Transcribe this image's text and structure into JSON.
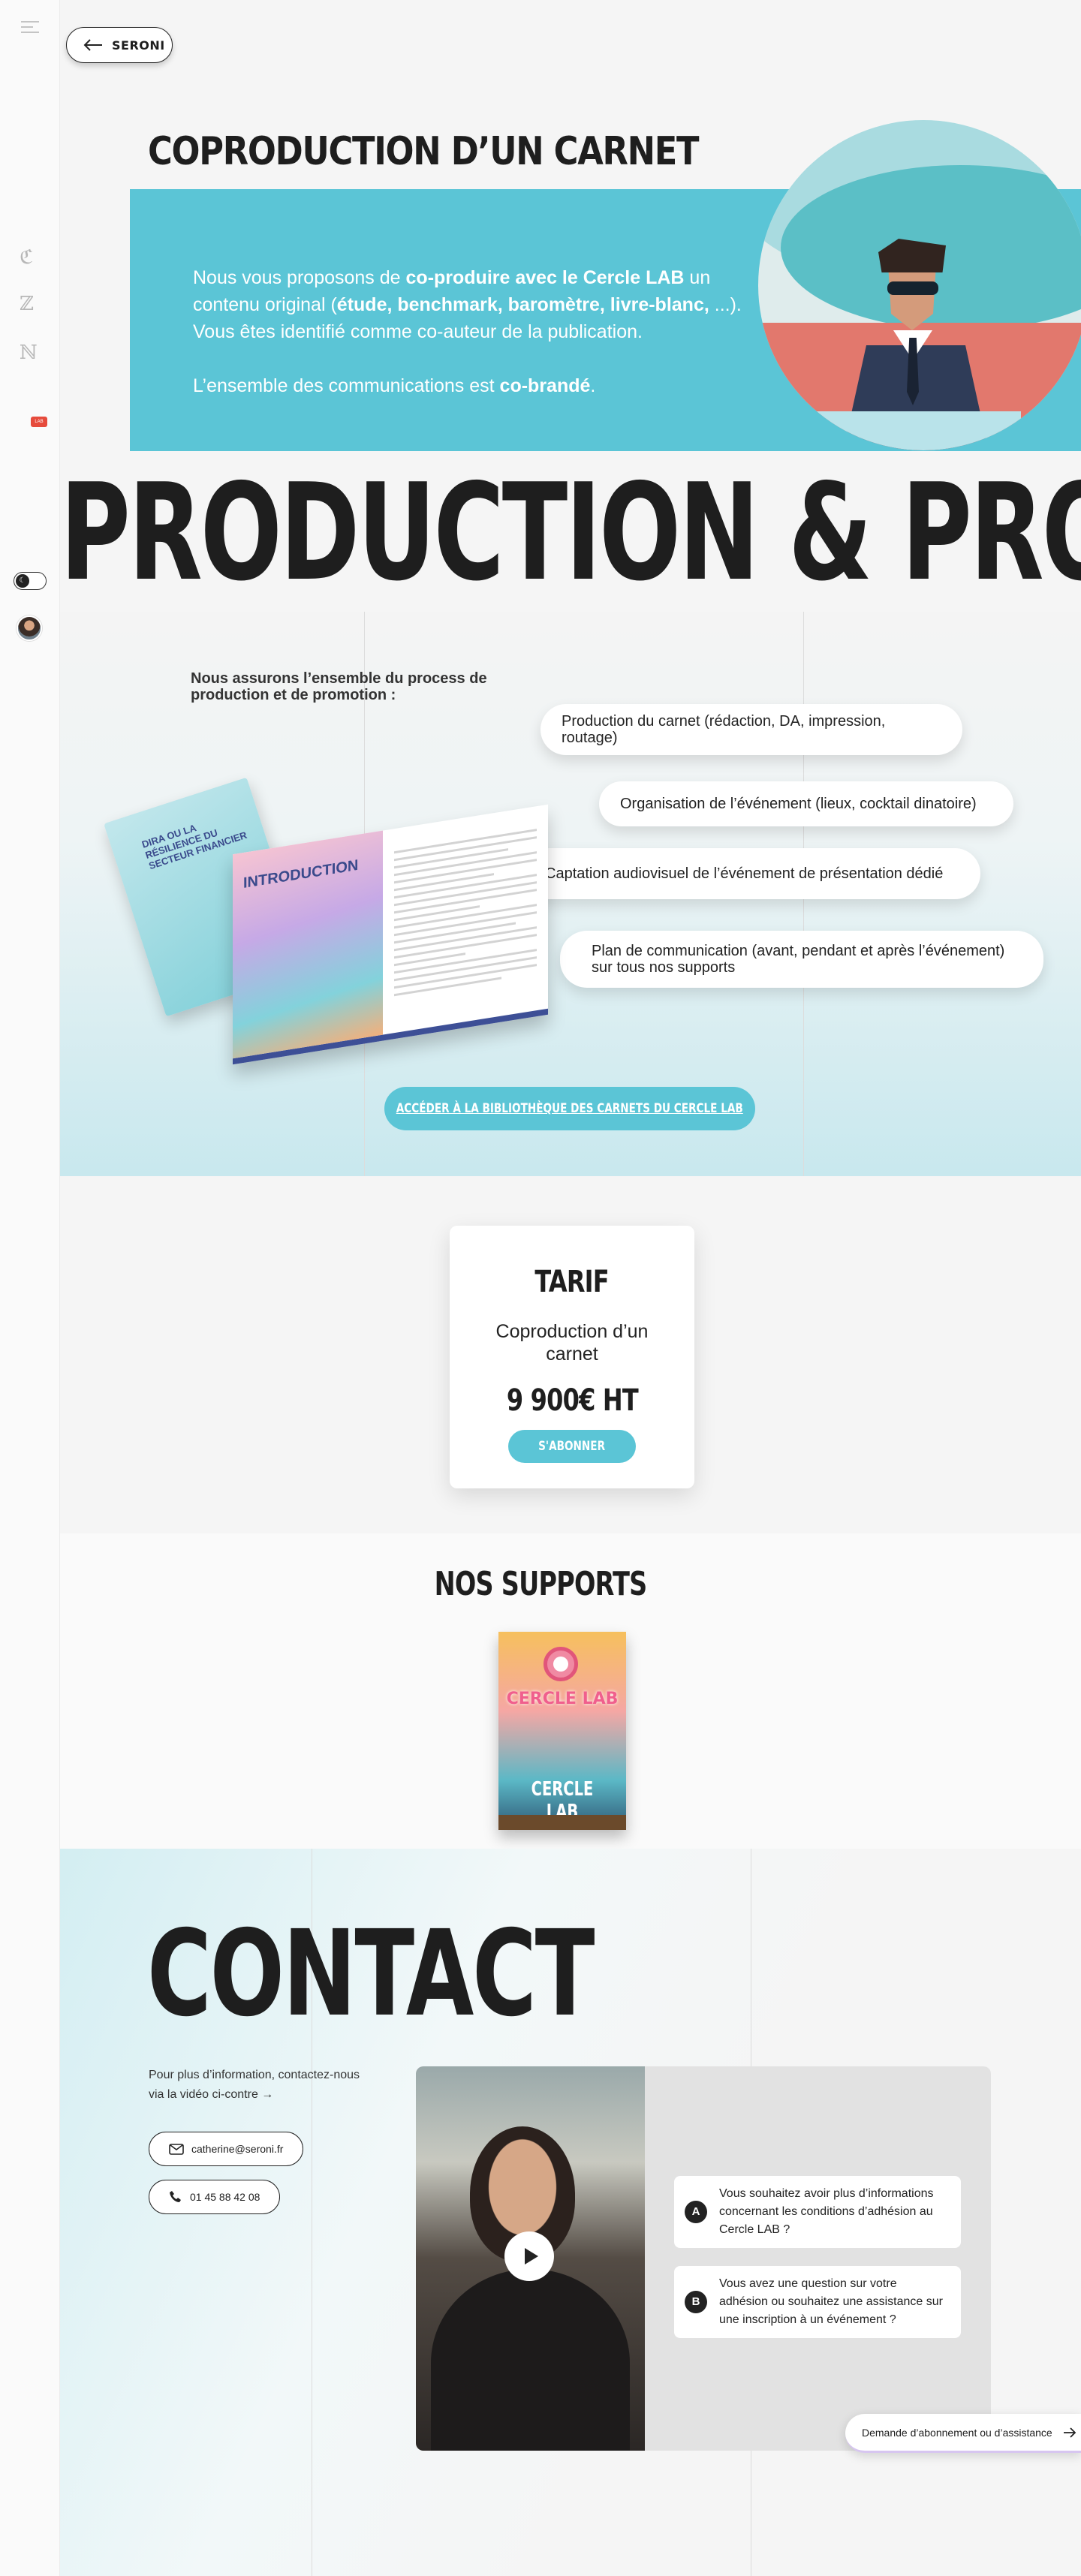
{
  "nav": {
    "back_label": "SERONI",
    "side_glyphs": [
      "ℭ",
      "ℤ",
      "ℕ"
    ],
    "side_badge": "LAB"
  },
  "coproduction": {
    "title": "COPRODUCTION D’UN CARNET",
    "p1_a": "Nous vous proposons de ",
    "p1_b": "co-produire avec le Cercle LAB",
    "p1_c": " un contenu original (",
    "p1_d": "étude, benchmark, baromètre, livre-blanc,",
    "p1_e": " ...). Vous êtes identifié comme co-auteur de la publication.",
    "p2_a": "L’ensemble des communications est ",
    "p2_b": "co-brandé",
    "p2_c": "."
  },
  "production": {
    "big_title": "PRODUCTION & PROMOTION",
    "intro": "Nous assurons l’ensemble du process de production et de promotion :",
    "services": [
      "Production du carnet (rédaction, DA, impression, routage)",
      "Organisation de l’événement (lieux, cocktail dinatoire)",
      "Captation audiovisuel de l’événement de présentation dédié",
      "Plan de communication (avant, pendant et après l’événement) sur tous nos supports"
    ],
    "book_back_title": "DIRA OU LA RÉSILIENCE DU SECTEUR FINANCIER",
    "book_intro_label": "INTRODUCTION",
    "cta_label": "ACCÉDER À LA BIBLIOTHÈQUE DES CARNETS DU CERCLE LAB"
  },
  "tarif": {
    "title": "TARIF",
    "subtitle": "Coproduction d’un carnet",
    "price": "9 900€ HT",
    "button": "S'ABONNER"
  },
  "supports": {
    "title": "NOS SUPPORTS",
    "poster_neon": "CERCLE LAB",
    "poster_label": "CERCLE LAB"
  },
  "contact": {
    "title": "CONTACT",
    "text": "Pour plus d’information, contactez-nous via la vidéo ci-contre →",
    "email": "catherine@seroni.fr",
    "phone": "01 45 88 42 08",
    "questions": [
      {
        "letter": "A",
        "text": "Vous souhaitez avoir plus d’informations concernant les conditions d’adhésion au Cercle LAB ?"
      },
      {
        "letter": "B",
        "text": "Vous avez une question sur votre adhésion ou souhaitez une assistance sur une inscription à un événement ?"
      }
    ],
    "help_label": "Demande d’abonnement ou d’assistance"
  },
  "colors": {
    "accent": "#5bc5d6",
    "text": "#1e1e1e",
    "background": "#f5f5f5"
  }
}
